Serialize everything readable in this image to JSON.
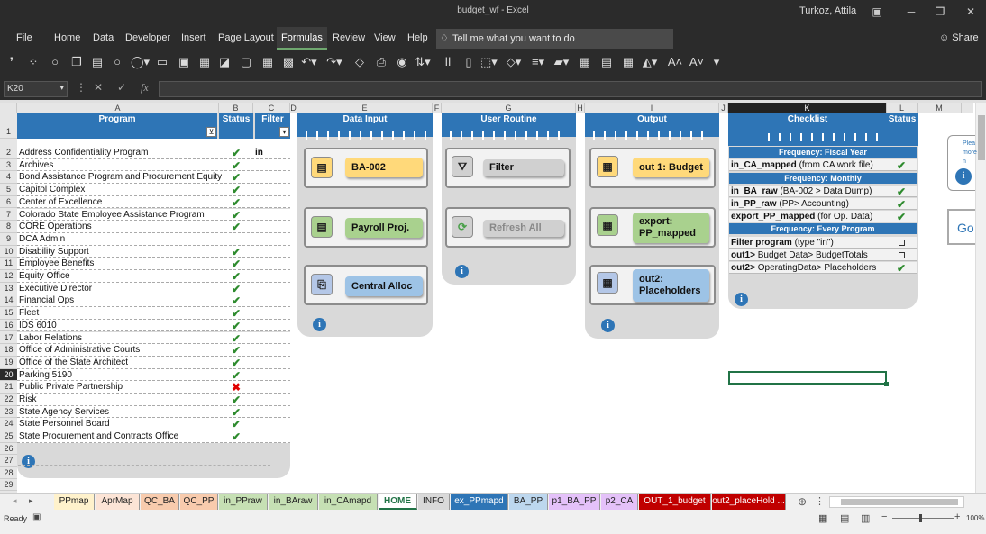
{
  "window": {
    "title": "budget_wf  -  Excel",
    "user": "Turkoz, Attila"
  },
  "menu": {
    "items": [
      "File",
      "Home",
      "Data",
      "Developer",
      "Insert",
      "Page Layout",
      "Formulas",
      "Review",
      "View",
      "Help"
    ],
    "active": "Formulas",
    "tell_me": "Tell me what you want to do",
    "share": "Share"
  },
  "formula_bar": {
    "name_box": "K20",
    "value": ""
  },
  "columns": [
    "A",
    "B",
    "C",
    "D",
    "E",
    "F",
    "G",
    "H",
    "I",
    "J",
    "K",
    "L",
    "M"
  ],
  "selected_column": "K",
  "selected_row": "20",
  "program_table": {
    "header_program": "Program",
    "header_status": "Status",
    "header_filter": "Filter",
    "filter_value": "in",
    "rows": [
      {
        "row": "2",
        "name": "Address Confidentiality Program",
        "status": "ok"
      },
      {
        "row": "3",
        "name": "Archives",
        "status": "ok"
      },
      {
        "row": "4",
        "name": "Bond Assistance Program and Procurement Equity",
        "status": "ok"
      },
      {
        "row": "5",
        "name": "Capitol Complex",
        "status": "ok"
      },
      {
        "row": "6",
        "name": "Center of Excellence",
        "status": "ok"
      },
      {
        "row": "7",
        "name": "Colorado State Employee Assistance Program",
        "status": "ok"
      },
      {
        "row": "8",
        "name": "CORE Operations",
        "status": "ok"
      },
      {
        "row": "9",
        "name": "DCA Admin",
        "status": "none"
      },
      {
        "row": "10",
        "name": "Disability Support",
        "status": "ok"
      },
      {
        "row": "11",
        "name": "Employee Benefits",
        "status": "ok"
      },
      {
        "row": "12",
        "name": "Equity Office",
        "status": "ok"
      },
      {
        "row": "13",
        "name": "Executive Director",
        "status": "ok"
      },
      {
        "row": "14",
        "name": "Financial Ops",
        "status": "ok"
      },
      {
        "row": "15",
        "name": "Fleet",
        "status": "ok"
      },
      {
        "row": "16",
        "name": "IDS 6010",
        "status": "ok"
      },
      {
        "row": "17",
        "name": "Labor Relations",
        "status": "ok"
      },
      {
        "row": "18",
        "name": "Office of Administrative Courts",
        "status": "ok"
      },
      {
        "row": "19",
        "name": "Office of the State Architect",
        "status": "ok"
      },
      {
        "row": "20",
        "name": "Parking 5190",
        "status": "ok"
      },
      {
        "row": "21",
        "name": "Public Private Partnership",
        "status": "bad"
      },
      {
        "row": "22",
        "name": "Risk",
        "status": "ok"
      },
      {
        "row": "23",
        "name": "State Agency Services",
        "status": "ok"
      },
      {
        "row": "24",
        "name": "State Personnel Board",
        "status": "ok"
      },
      {
        "row": "25",
        "name": "State Procurement  and Contracts Office",
        "status": "ok"
      }
    ],
    "row_one": "1",
    "extra_rows": [
      "26",
      "27",
      "28",
      "29",
      "30"
    ]
  },
  "data_input": {
    "header": "Data Input",
    "buttons": [
      "BA-002",
      "Payroll Proj.",
      "Central Alloc"
    ]
  },
  "user_routine": {
    "header": "User Routine",
    "buttons": [
      "Filter",
      "Refresh All"
    ]
  },
  "output": {
    "header": "Output",
    "buttons": [
      "out 1: Budget",
      "export:\nPP_mapped",
      "out2:\nPlaceholders"
    ]
  },
  "checklist": {
    "header": "Checklist",
    "status_header": "Status",
    "freq_fiscal": "Frequency: Fiscal Year",
    "freq_monthly": "Frequency: Monthly",
    "freq_every": "Frequency: Every Program",
    "items": [
      {
        "bold": "in_CA_mapped",
        "rest": " (from CA work file)",
        "state": "check"
      },
      {
        "bold": "in_BA_raw",
        "rest": " (BA-002 > Data Dump)",
        "state": "check"
      },
      {
        "bold": "in_PP_raw",
        "rest": " (PP> Accounting)",
        "state": "check"
      },
      {
        "bold": "export_PP_mapped",
        "rest": " (for Op. Data)",
        "state": "check"
      },
      {
        "bold": "Filter program",
        "rest": " (type \"in\")",
        "state": "box"
      },
      {
        "bold": "out1>",
        "rest": " Budget Data> BudgetTotals",
        "state": "box"
      },
      {
        "bold": "out2>",
        "rest": " OperatingData> Placeholders",
        "state": "check"
      }
    ]
  },
  "side_note": {
    "text": "Plea\nmore\nn",
    "go": "Go"
  },
  "sheet_tabs": [
    {
      "name": "PPmap",
      "color": "#fff2cc"
    },
    {
      "name": "AprMap",
      "color": "#fce4d6"
    },
    {
      "name": "QC_BA",
      "color": "#f8cbad"
    },
    {
      "name": "QC_PP",
      "color": "#f8cbad"
    },
    {
      "name": "in_PPraw",
      "color": "#c6e0b4"
    },
    {
      "name": "in_BAraw",
      "color": "#c6e0b4"
    },
    {
      "name": "in_CAmapd",
      "color": "#c6e0b4"
    },
    {
      "name": "HOME",
      "color": "#ffffff"
    },
    {
      "name": "INFO",
      "color": "#d9d9d9"
    },
    {
      "name": "ex_PPmapd",
      "color": "#2e75b6"
    },
    {
      "name": "BA_PP",
      "color": "#bdd7ee"
    },
    {
      "name": "p1_BA_PP",
      "color": "#e4c1f9"
    },
    {
      "name": "p2_CA",
      "color": "#e4c1f9"
    },
    {
      "name": "OUT_1_budget",
      "color": "#c00000"
    },
    {
      "name": "out2_placeHold ...",
      "color": "#c00000"
    }
  ],
  "status": {
    "ready": "Ready",
    "zoom": "100%"
  }
}
